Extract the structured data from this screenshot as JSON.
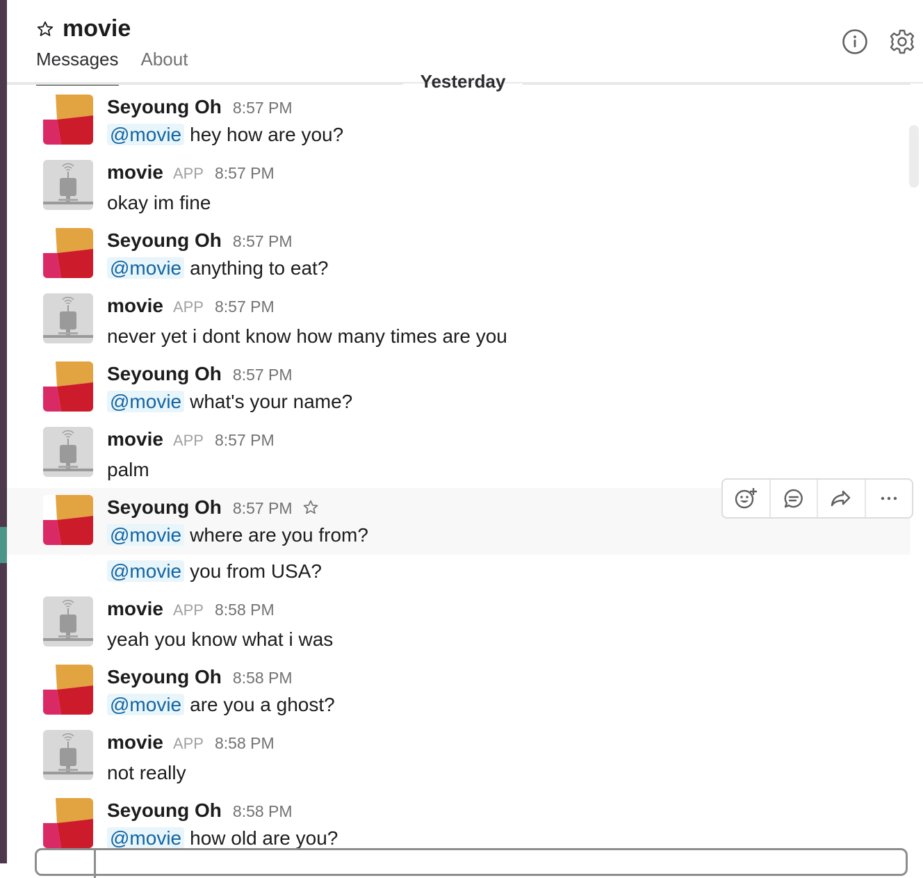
{
  "channel": {
    "name": "movie"
  },
  "tabs": [
    {
      "label": "Messages"
    },
    {
      "label": "About"
    }
  ],
  "day_divider": "Yesterday",
  "messages": [
    {
      "sender": "Seyoung Oh",
      "time": "8:57 PM",
      "mention": "@movie",
      "text": "hey how are you?"
    },
    {
      "sender": "movie",
      "badge": "APP",
      "time": "8:57 PM",
      "text": "okay im fine"
    },
    {
      "sender": "Seyoung Oh",
      "time": "8:57 PM",
      "mention": "@movie",
      "text": "anything to eat?"
    },
    {
      "sender": "movie",
      "badge": "APP",
      "time": "8:57 PM",
      "text": "never yet i dont know how many times are you"
    },
    {
      "sender": "Seyoung Oh",
      "time": "8:57 PM",
      "mention": "@movie",
      "text": "what's your name?"
    },
    {
      "sender": "movie",
      "badge": "APP",
      "time": "8:57 PM",
      "text": "palm"
    },
    {
      "sender": "Seyoung Oh",
      "time": "8:57 PM",
      "mention": "@movie",
      "text": "where are you from?"
    },
    {
      "mention": "@movie",
      "text": "you from USA?"
    },
    {
      "sender": "movie",
      "badge": "APP",
      "time": "8:58 PM",
      "text": "yeah you know what i was"
    },
    {
      "sender": "Seyoung Oh",
      "time": "8:58 PM",
      "mention": "@movie",
      "text": "are you a ghost?"
    },
    {
      "sender": "movie",
      "badge": "APP",
      "time": "8:58 PM",
      "text": "not really"
    },
    {
      "sender": "Seyoung Oh",
      "time": "8:58 PM",
      "mention": "@movie",
      "text": "how old are you?"
    }
  ],
  "icons": {
    "channel_star": "star-outline-icon",
    "info": "info-icon",
    "settings": "gear-icon",
    "toolbar": [
      "add-reaction-icon",
      "start-thread-icon",
      "share-message-icon",
      "more-actions-icon"
    ]
  },
  "colors": {
    "accent_link": "#1264a3",
    "sidebar": "#4d394b",
    "avatar_orange": "#e2a341",
    "avatar_red": "#cc1b2b",
    "avatar_pink": "#da2a66"
  }
}
